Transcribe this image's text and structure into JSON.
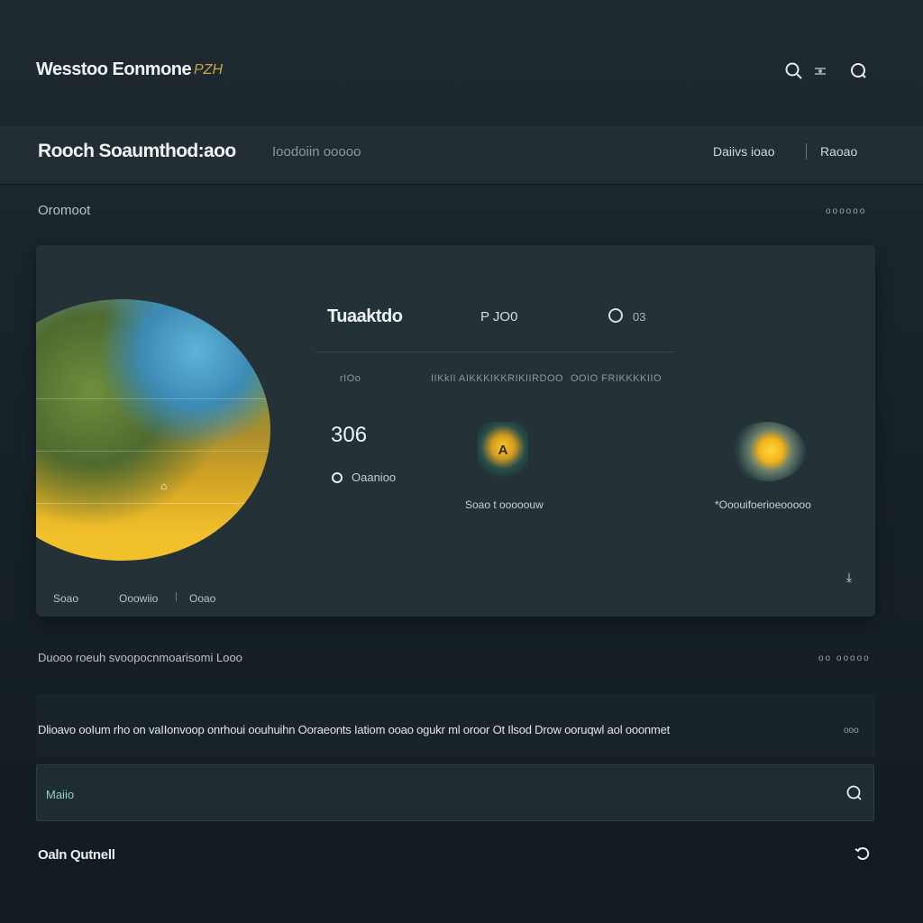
{
  "app": {
    "brand": "Wesstoo Eonmone",
    "brand_tag": "PZH"
  },
  "topbar": {
    "icons": [
      "search-icon",
      "settings-icon",
      "search-icon"
    ]
  },
  "header": {
    "title": "Rooch Soaumthod:aoo",
    "subtitle": "Ioodoiin ooooo",
    "links": [
      "Daiivs ioao",
      "Raoao"
    ]
  },
  "overview": {
    "label": "Oromoot",
    "meta": "oooooo"
  },
  "card": {
    "title": "Tuaaktdo",
    "chip_label": "P JO0",
    "chip2_label": "03",
    "column_heads": [
      "rIOo",
      "IIKkII AIKKKIKKRIKIIRDOO",
      "OOIO  FRIKKKKIIO"
    ],
    "big_number": "306",
    "status_label": "Oaanioo",
    "badges": [
      {
        "icon": "shield-badge-icon",
        "glyph": "A",
        "label": "Soao t ooooouw"
      },
      {
        "icon": "sun-badge-icon",
        "label": "*Ooouifoerioeooooo"
      }
    ],
    "footer_items": [
      "Soao",
      "Ooowiio",
      "Ooao"
    ],
    "corner_icon": "expand-icon"
  },
  "section2": {
    "label": "Duooo roeuh svoopocnmoarisomi Looo",
    "meta": "oo ooooo"
  },
  "description": {
    "text": "Dlioavo ooIum rho on vaIIonvoop onrhoui oouhuihn Ooraeonts Iatiom ooao ogukr ml oroor Ot Ilsod  Drow ooruqwl aol ooonmet",
    "suffix": "ooo"
  },
  "search": {
    "placeholder": "Maiio"
  },
  "footer": {
    "label": "Oaln Qutnell",
    "icon": "refresh-icon"
  }
}
